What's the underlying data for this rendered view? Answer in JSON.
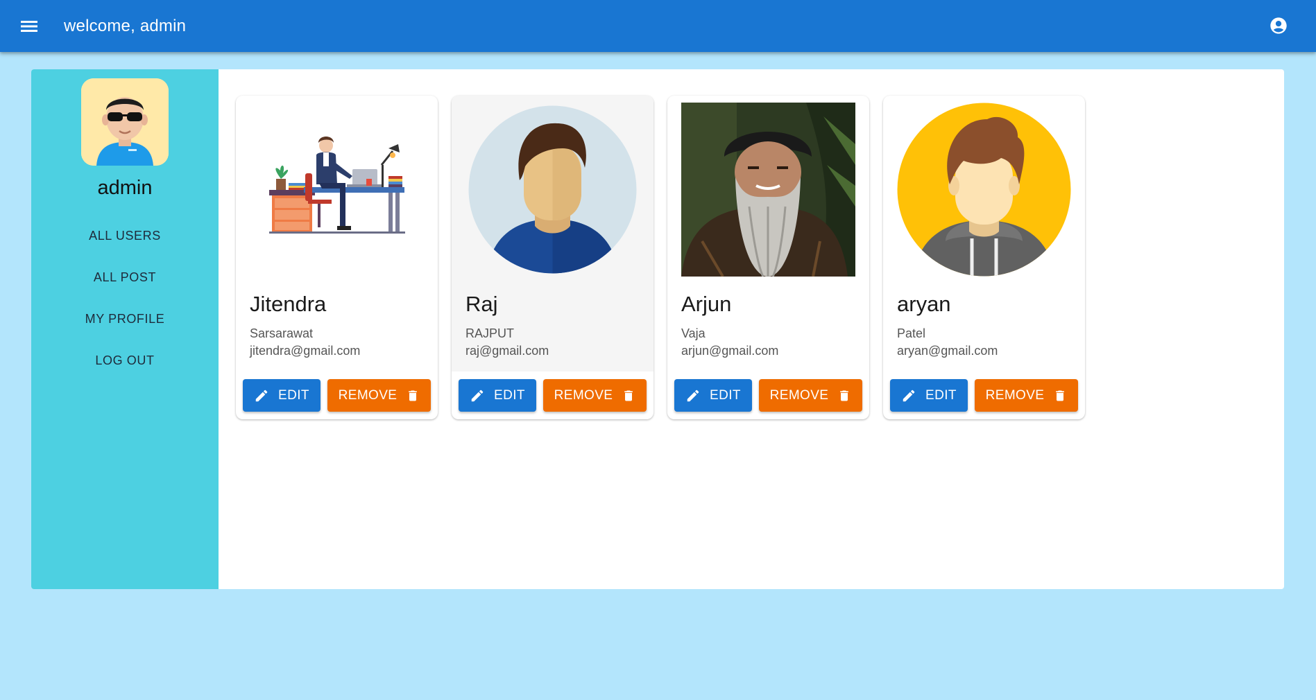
{
  "appbar": {
    "title": "welcome, admin",
    "menu_icon": "menu-icon",
    "account_icon": "account-circle-icon"
  },
  "sidebar": {
    "username": "admin",
    "items": [
      {
        "label": "ALL USERS"
      },
      {
        "label": "ALL POST"
      },
      {
        "label": "MY PROFILE"
      },
      {
        "label": "LOG OUT"
      }
    ]
  },
  "users": [
    {
      "first": "Jitendra",
      "last": "Sarsarawat",
      "email": "jitendra@gmail.com",
      "edit": "EDIT",
      "remove": "REMOVE"
    },
    {
      "first": "Raj",
      "last": "RAJPUT",
      "email": "raj@gmail.com",
      "edit": "EDIT",
      "remove": "REMOVE"
    },
    {
      "first": "Arjun",
      "last": "Vaja",
      "email": "arjun@gmail.com",
      "edit": "EDIT",
      "remove": "REMOVE"
    },
    {
      "first": "aryan",
      "last": "Patel",
      "email": "aryan@gmail.com",
      "edit": "EDIT",
      "remove": "REMOVE"
    }
  ],
  "colors": {
    "appbar": "#1976d2",
    "background": "#b3e5fc",
    "sidebar": "#4dd0e1",
    "edit_button": "#1976d2",
    "remove_button": "#ef6c00"
  }
}
